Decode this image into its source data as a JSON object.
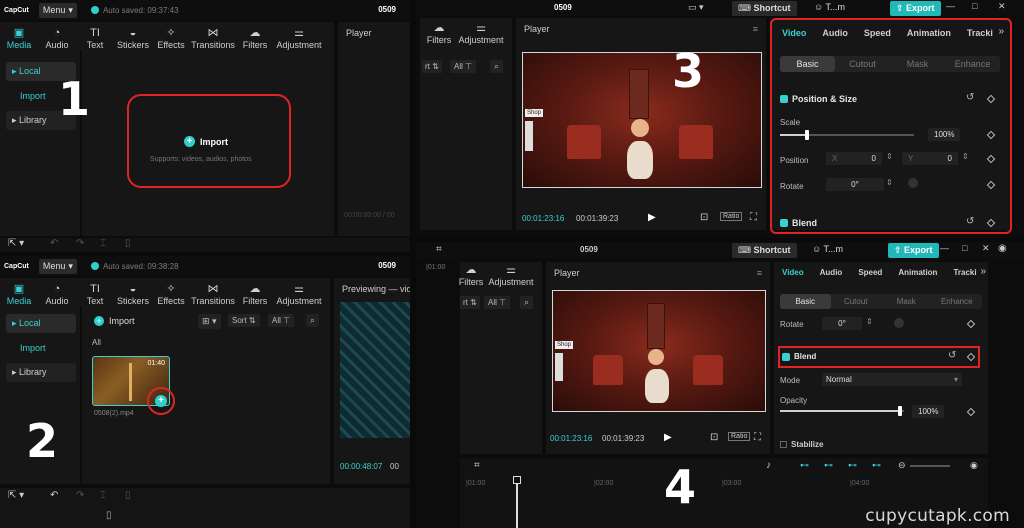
{
  "app": {
    "logo": "CapCut",
    "menu_label": "Menu",
    "project_title": "0509"
  },
  "step_numbers": [
    "1",
    "2",
    "3",
    "4"
  ],
  "panel1": {
    "autosave": "Auto saved: 09:37:43",
    "tools": [
      "Media",
      "Audio",
      "Text",
      "Stickers",
      "Effects",
      "Transitions",
      "Filters",
      "Adjustment"
    ],
    "sidebar": [
      "Local",
      "Import",
      "Library"
    ],
    "import_label": "Import",
    "import_hint": "Supports: videos, audios, photos",
    "player_label": "Player",
    "player_time": "00:00:00:00 / 00"
  },
  "panel2": {
    "autosave": "Auto saved: 09:38:28",
    "tools": [
      "Media",
      "Audio",
      "Text",
      "Stickers",
      "Effects",
      "Transitions",
      "Filters",
      "Adjustment"
    ],
    "sidebar": [
      "Local",
      "Import",
      "Library"
    ],
    "import_label": "Import",
    "sort_label": "Sort",
    "all_label": "All",
    "folder_all": "All",
    "clip_duration": "01:40",
    "clip_name": "0508(2).mp4",
    "preview_label": "Previewing — vid",
    "preview_time": "00:00:48:07",
    "preview_time2": "00"
  },
  "panel3": {
    "project_title": "0509",
    "shortcut_label": "Shortcut",
    "user_label": "T...m",
    "export_label": "Export",
    "left_tools": [
      "Filters",
      "Adjustment"
    ],
    "left_filter": [
      "All"
    ],
    "player_label": "Player",
    "tabs": [
      "Video",
      "Audio",
      "Speed",
      "Animation",
      "Tracki"
    ],
    "subtabs": [
      "Basic",
      "Cutout",
      "Mask",
      "Enhance"
    ],
    "section1": "Position & Size",
    "scale_label": "Scale",
    "scale_value": "100%",
    "scale_fraction": 0.2,
    "position_label": "Position",
    "pos_x_label": "X",
    "pos_x": "0",
    "pos_y_label": "Y",
    "pos_y": "0",
    "rotate_label": "Rotate",
    "rotate_value": "0°",
    "blend_label": "Blend",
    "time_current": "00:01:23:16",
    "time_total": "00:01:39:23",
    "ratio_label": "Ratio",
    "shop_label": "Shop"
  },
  "panel4": {
    "project_title": "0509",
    "shortcut_label": "Shortcut",
    "user_label": "T...m",
    "export_label": "Export",
    "left_tools": [
      "Filters",
      "Adjustment"
    ],
    "left_filter": [
      "All"
    ],
    "ruler_start": "|01:00",
    "player_label": "Player",
    "tabs": [
      "Video",
      "Audio",
      "Speed",
      "Animation",
      "Tracki"
    ],
    "subtabs": [
      "Basic",
      "Cutout",
      "Mask",
      "Enhance"
    ],
    "rotate_label": "Rotate",
    "rotate_value": "0°",
    "blend_label": "Blend",
    "mode_label": "Mode",
    "mode_value": "Normal",
    "opacity_label": "Opacity",
    "opacity_value": "100%",
    "opacity_fraction": 0.97,
    "stabilize_label": "Stabilize",
    "time_current": "00:01:23:16",
    "time_total": "00:01:39:23",
    "ratio_label": "Ratio",
    "shop_label": "Shop",
    "ruler": [
      "|01:00",
      "|02:00",
      "|03:00",
      "|04:00"
    ]
  },
  "watermark": "cupycutapk.com",
  "colors": {
    "accent": "#3bd0d0",
    "highlight": "#e02424"
  }
}
